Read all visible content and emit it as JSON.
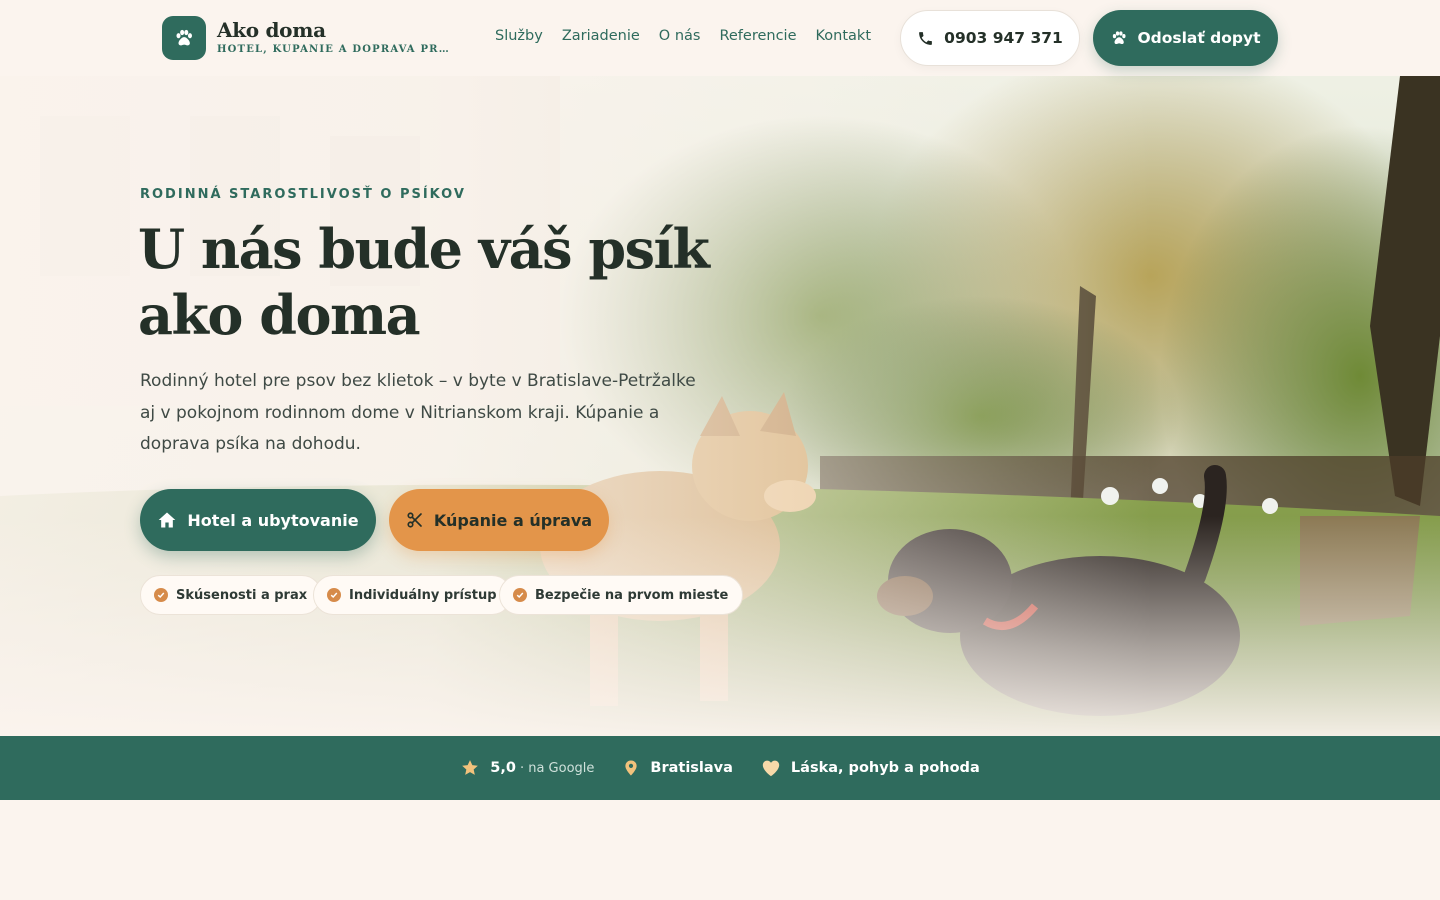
{
  "brand": {
    "name": "Ako doma",
    "tagline": "HOTEL, KÚPANIE A DOPRAVA PRE PS…"
  },
  "nav": {
    "items": [
      {
        "label": "Služby"
      },
      {
        "label": "Zariadenie"
      },
      {
        "label": "O nás"
      },
      {
        "label": "Referencie"
      },
      {
        "label": "Kontakt"
      }
    ]
  },
  "header": {
    "phone": "0903 947 371",
    "cta": "Odoslať dopyt"
  },
  "hero": {
    "eyebrow": "RODINNÁ STAROSTLIVOSŤ O PSÍKOV",
    "headline": "U nás bude váš psík ako doma",
    "lead": "Rodinný hotel pre psov bez klietok – v byte v Bratislave-Petržalke aj v pokojnom rodinnom dome v Nitrianskom kraji. Kúpanie a doprava psíka na dohodu.",
    "primary_button": "Hotel a ubytovanie",
    "secondary_button": "Kúpanie a úprava",
    "features": [
      {
        "label": "Skúsenosti a prax"
      },
      {
        "label": "Individuálny prístup"
      },
      {
        "label": "Bezpečie na prvom mieste"
      }
    ]
  },
  "band": {
    "rating": "5,0",
    "rating_suffix": "· na Google",
    "location": "Bratislava",
    "motto": "Láska, pohyb a pohoda"
  },
  "colors": {
    "primary": "#2f6b5d",
    "accent": "#e3954a",
    "background": "#fbf4ee",
    "text": "#243028"
  },
  "icons": [
    "paw-icon",
    "phone-icon",
    "home-icon",
    "scissors-icon",
    "check-icon",
    "star-icon",
    "map-pin-icon",
    "heart-icon"
  ]
}
